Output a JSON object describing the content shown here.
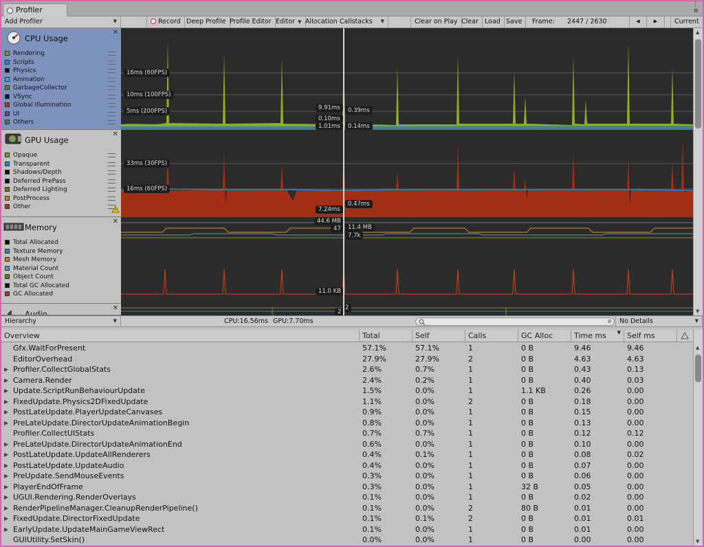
{
  "window": {
    "tab_title": "Profiler",
    "menu_icon": "kebab-menu-icon"
  },
  "toolbar": {
    "add_profiler": "Add Profiler",
    "record": "Record",
    "deep_profile": "Deep Profile",
    "profile_editor": "Profile Editor",
    "editor": "Editor",
    "allocation_callstacks": "Allocation Callstacks",
    "clear_on_play": "Clear on Play",
    "clear": "Clear",
    "load": "Load",
    "save": "Save",
    "frame_label": "Frame:",
    "frame_value": "2447 / 2630",
    "prev": "◀",
    "next": "▶",
    "current": "Current"
  },
  "cpu": {
    "title": "CPU Usage",
    "items": [
      {
        "label": "Rendering",
        "color": "#7f9c16"
      },
      {
        "label": "Scripts",
        "color": "#3a7fb0"
      },
      {
        "label": "Physics",
        "color": "#111111"
      },
      {
        "label": "Animation",
        "color": "#39b0c9"
      },
      {
        "label": "GarbageCollector",
        "color": "#5f7a3a"
      },
      {
        "label": "VSync",
        "color": "#0d1a2a"
      },
      {
        "label": "Global Illumination",
        "color": "#a33a2a"
      },
      {
        "label": "UI",
        "color": "#6a3ea3"
      },
      {
        "label": "Others",
        "color": "#3f7a6a"
      }
    ],
    "lines": {
      "l60": "16ms (60FPS)",
      "l100": "10ms (100FPS)",
      "l200": "5ms (200FPS)"
    },
    "labels": {
      "a": "9.91ms",
      "b": "0.39ms",
      "c": "0.10ms",
      "d": "1.01ms",
      "e": "0.14ms"
    }
  },
  "gpu": {
    "title": "GPU Usage",
    "items": [
      {
        "label": "Opaque",
        "color": "#7f9c16"
      },
      {
        "label": "Transparent",
        "color": "#3a7fb0"
      },
      {
        "label": "Shadows/Depth",
        "color": "#111111"
      },
      {
        "label": "Deferred PrePass",
        "color": "#111111"
      },
      {
        "label": "Deferred Lighting",
        "color": "#6f6f20"
      },
      {
        "label": "PostProcess",
        "color": "#b08a20"
      },
      {
        "label": "Other",
        "color": "#a33a1a"
      }
    ],
    "lines": {
      "l30": "33ms (30FPS)",
      "l60": "16ms (60FPS)"
    },
    "labels": {
      "a": "7.24ms",
      "b": "0.47ms"
    }
  },
  "memory": {
    "title": "Memory",
    "items": [
      {
        "label": "Total Allocated",
        "color": "#111111"
      },
      {
        "label": "Texture Memory",
        "color": "#3a7fb0"
      },
      {
        "label": "Mesh Memory",
        "color": "#c87a20"
      },
      {
        "label": "Material Count",
        "color": "#5a9ab0"
      },
      {
        "label": "Object Count",
        "color": "#6f6f20"
      },
      {
        "label": "Total GC Allocated",
        "color": "#111111"
      },
      {
        "label": "GC Allocated",
        "color": "#a33a1a"
      }
    ],
    "labels": {
      "a": "44.6 MB",
      "b": "47",
      "c": "11.4 MB",
      "d": "7.7k",
      "e": "11.0 KB"
    }
  },
  "audio": {
    "title": "Audio",
    "labels": {
      "a": "2",
      "b": "2"
    }
  },
  "lower": {
    "view": "Hierarchy",
    "cpu": "CPU:16.56ms",
    "gpu": "GPU:7.70ms",
    "details": "No Details"
  },
  "table": {
    "headers": [
      "Overview",
      "Total",
      "Self",
      "Calls",
      "GC Alloc",
      "Time ms",
      "Self ms"
    ],
    "rows": [
      {
        "name": "Gfx.WaitForPresent",
        "exp": false,
        "total": "57.1%",
        "self": "57.1%",
        "calls": "1",
        "gc": "0 B",
        "time": "9.46",
        "selfms": "9.46"
      },
      {
        "name": "EditorOverhead",
        "exp": false,
        "total": "27.9%",
        "self": "27.9%",
        "calls": "2",
        "gc": "0 B",
        "time": "4.63",
        "selfms": "4.63"
      },
      {
        "name": "Profiler.CollectGlobalStats",
        "exp": true,
        "total": "2.6%",
        "self": "0.7%",
        "calls": "1",
        "gc": "0 B",
        "time": "0.43",
        "selfms": "0.13"
      },
      {
        "name": "Camera.Render",
        "exp": true,
        "total": "2.4%",
        "self": "0.2%",
        "calls": "1",
        "gc": "0 B",
        "time": "0.40",
        "selfms": "0.03"
      },
      {
        "name": "Update.ScriptRunBehaviourUpdate",
        "exp": true,
        "total": "1.5%",
        "self": "0.0%",
        "calls": "1",
        "gc": "1.1 KB",
        "time": "0.26",
        "selfms": "0.00"
      },
      {
        "name": "FixedUpdate.Physics2DFixedUpdate",
        "exp": true,
        "total": "1.1%",
        "self": "0.0%",
        "calls": "2",
        "gc": "0 B",
        "time": "0.18",
        "selfms": "0.00"
      },
      {
        "name": "PostLateUpdate.PlayerUpdateCanvases",
        "exp": true,
        "total": "0.9%",
        "self": "0.0%",
        "calls": "1",
        "gc": "0 B",
        "time": "0.15",
        "selfms": "0.00"
      },
      {
        "name": "PreLateUpdate.DirectorUpdateAnimationBegin",
        "exp": true,
        "total": "0.8%",
        "self": "0.0%",
        "calls": "1",
        "gc": "0 B",
        "time": "0.13",
        "selfms": "0.00"
      },
      {
        "name": "Profiler.CollectUIStats",
        "exp": false,
        "total": "0.7%",
        "self": "0.7%",
        "calls": "1",
        "gc": "0 B",
        "time": "0.12",
        "selfms": "0.12"
      },
      {
        "name": "PreLateUpdate.DirectorUpdateAnimationEnd",
        "exp": true,
        "total": "0.6%",
        "self": "0.0%",
        "calls": "1",
        "gc": "0 B",
        "time": "0.10",
        "selfms": "0.00"
      },
      {
        "name": "PostLateUpdate.UpdateAllRenderers",
        "exp": true,
        "total": "0.4%",
        "self": "0.1%",
        "calls": "1",
        "gc": "0 B",
        "time": "0.08",
        "selfms": "0.02"
      },
      {
        "name": "PostLateUpdate.UpdateAudio",
        "exp": true,
        "total": "0.4%",
        "self": "0.0%",
        "calls": "1",
        "gc": "0 B",
        "time": "0.07",
        "selfms": "0.00"
      },
      {
        "name": "PreUpdate.SendMouseEvents",
        "exp": true,
        "total": "0.3%",
        "self": "0.0%",
        "calls": "1",
        "gc": "0 B",
        "time": "0.06",
        "selfms": "0.00"
      },
      {
        "name": "PlayerEndOfFrame",
        "exp": true,
        "total": "0.3%",
        "self": "0.0%",
        "calls": "1",
        "gc": "32 B",
        "time": "0.05",
        "selfms": "0.00"
      },
      {
        "name": "UGUI.Rendering.RenderOverlays",
        "exp": true,
        "total": "0.1%",
        "self": "0.0%",
        "calls": "1",
        "gc": "0 B",
        "time": "0.02",
        "selfms": "0.00"
      },
      {
        "name": "RenderPipelineManager.CleanupRenderPipeline()",
        "exp": true,
        "total": "0.1%",
        "self": "0.0%",
        "calls": "2",
        "gc": "80 B",
        "time": "0.01",
        "selfms": "0.00"
      },
      {
        "name": "FixedUpdate.DirectorFixedUpdate",
        "exp": true,
        "total": "0.1%",
        "self": "0.1%",
        "calls": "2",
        "gc": "0 B",
        "time": "0.01",
        "selfms": "0.01"
      },
      {
        "name": "EarlyUpdate.UpdateMainGameViewRect",
        "exp": true,
        "total": "0.1%",
        "self": "0.0%",
        "calls": "1",
        "gc": "0 B",
        "time": "0.01",
        "selfms": "0.00"
      },
      {
        "name": "GUIUtility.SetSkin()",
        "exp": false,
        "total": "0.0%",
        "self": "0.0%",
        "calls": "1",
        "gc": "0 B",
        "time": "0.00",
        "selfms": "0.00"
      }
    ]
  }
}
